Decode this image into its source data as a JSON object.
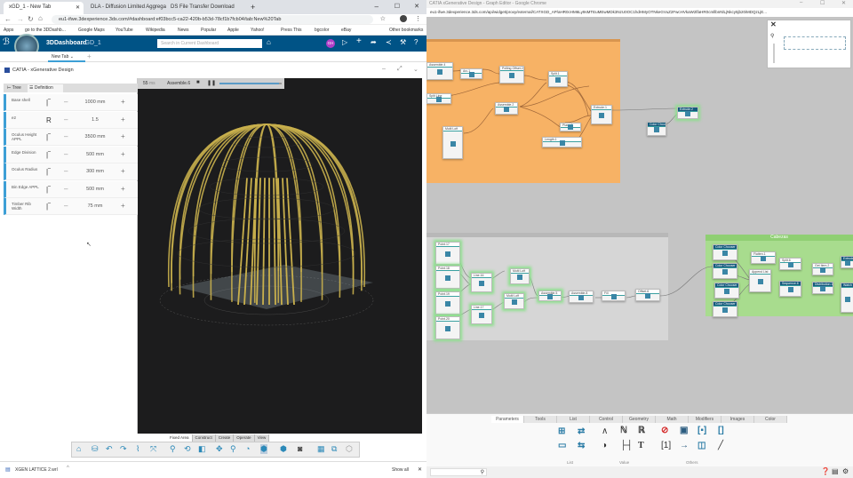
{
  "left_browser": {
    "tabs": [
      {
        "label": "xGD_1 - New Tab",
        "active": true
      },
      {
        "label": "DLA - Diffusion Limited Aggrega"
      },
      {
        "label": "DS File Transfer Download"
      }
    ],
    "url": "eu1-ifwe.3dexperience.3ds.com/#dashboard:ef03bcc5-ca22-420b-b53d-78cf1b7fcb04/tab:New%20Tab",
    "bookmarks": [
      "Apps",
      "go to the 3DDashb...",
      "Google Maps",
      "YouTube",
      "Wikipedia",
      "News",
      "Popular",
      "Apple",
      "Yahoo!",
      "Press This",
      "bgcolor",
      "eBay"
    ],
    "other_bookmarks": "Other bookmarks",
    "dashboard": {
      "brand": "3DDashboard",
      "name": "xGD_1",
      "search_placeholder": "Search in Current Dashboard",
      "avatar": "GH",
      "accent": "#005386"
    },
    "dash_tab": "New Tab",
    "app_title": "CATIA - xGenerative Design",
    "panel_tabs": [
      "Tree",
      "Definition"
    ],
    "params": [
      {
        "label": "Base shell",
        "glyph": "|‾",
        "value": "1000 mm"
      },
      {
        "label": "e2",
        "glyph": "R",
        "value": "1.5"
      },
      {
        "label": "Oculus Height APPL",
        "glyph": "|‾",
        "value": "3500 mm"
      },
      {
        "label": "Edge Division",
        "glyph": "|‾",
        "value": "500 mm"
      },
      {
        "label": "Oculus Radius",
        "glyph": "|‾",
        "value": "300 mm"
      },
      {
        "label": "Bin Edge APPL",
        "glyph": "|‾",
        "value": "500 mm"
      },
      {
        "label": "Timber Rib Width",
        "glyph": "|‾",
        "value": "75 mm"
      }
    ],
    "player": {
      "frame": "55",
      "unit": "ms",
      "label": "Assemble.6",
      "progress": 0.95
    },
    "action_tabs": [
      "Fixed Area",
      "Construct",
      "Create",
      "Operate",
      "View"
    ],
    "download": {
      "file": "XGEN LATTICE 2.wrl",
      "show_all": "Show all"
    },
    "dome_color": "#c9b04c"
  },
  "right_browser": {
    "title": "CATIA xGenerative Design - Graph Editor - Google Chrome",
    "url": "eu1-ifwe.3dexperience.3ds.com/api/widget/proxy/external/CATXGD_AP/aHR0cHM6Ly9sMTEuMEwMDk3NzU0OC1hdHMyOTNkeGVuZ2FwcHVkaW2lfaHR0cmllbnNlLjNkcy5jb20iMDQzLjE...",
    "groups": {
      "green": "Cabezas"
    },
    "nodes": {
      "orange": [
        "Assemble.4",
        "Arc.1",
        "Polling Offset.2",
        "Split.1",
        "Split Line",
        "Assemble.2",
        "Extrude.1",
        "Plane.1",
        "Length.1",
        "Multi Loft"
      ],
      "outside": [
        "Color Chooser",
        "Extrude.2"
      ],
      "gray": [
        "Point.17",
        "Point.18",
        "Point.19",
        "Point.20",
        "Line.16",
        "Line.17",
        "Multi Loft",
        "Multi Loft",
        "Assemble.5",
        "Assemble.8",
        "Fill",
        "Offset.6"
      ],
      "green": [
        "Color Chooser",
        "Color Chooser",
        "Color Chooser",
        "Color Chooser",
        "Flatten.1",
        "Append List",
        "Split.6",
        "Sequence.6",
        "Get Item.2",
        "Distribution.1",
        "Extrude",
        "Watch"
      ]
    },
    "bottom_tabs": [
      "Parameters",
      "Tools",
      "List",
      "Control",
      "Geometry",
      "Math",
      "Modifiers",
      "Images",
      "Color"
    ],
    "groups_labels": [
      "List",
      "Value",
      "Others"
    ],
    "status_color_orange": "#f7b265",
    "status_color_green": "#a8dc8e"
  }
}
